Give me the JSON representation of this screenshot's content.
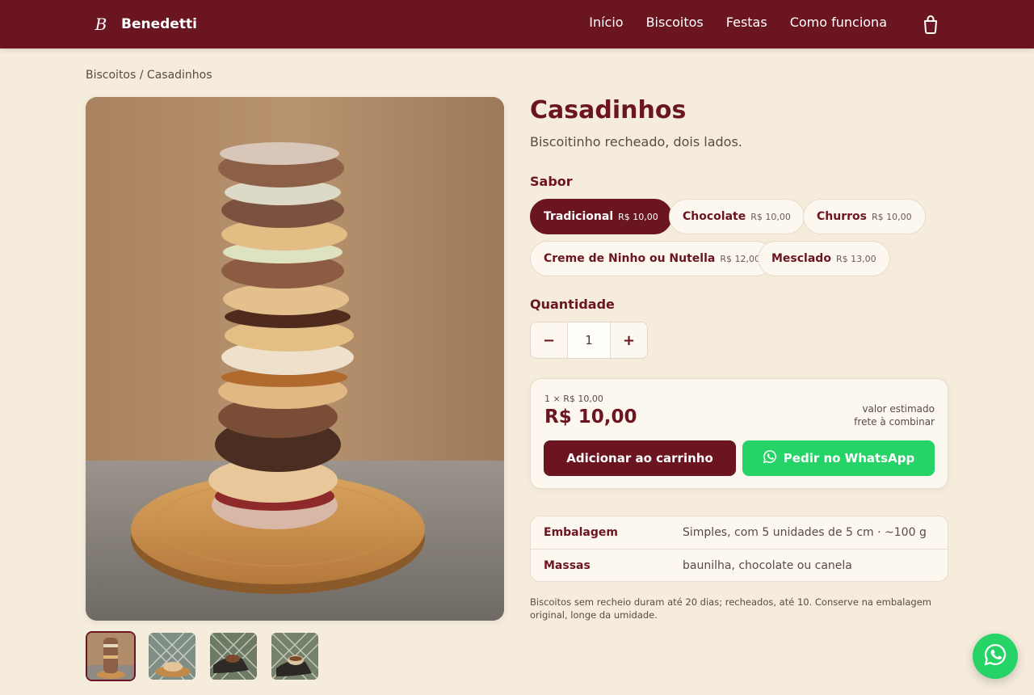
{
  "brand": {
    "name": "Benedetti",
    "monogram": "B"
  },
  "nav": {
    "items": [
      "Início",
      "Biscoitos",
      "Festas",
      "Como funciona"
    ]
  },
  "breadcrumb": {
    "parent": "Biscoitos",
    "separator": " / ",
    "current": "Casadinhos"
  },
  "product": {
    "title": "Casadinhos",
    "subtitle": "Biscoitinho recheado, dois lados."
  },
  "flavor": {
    "label": "Sabor",
    "selected": "Tradicional",
    "options": [
      {
        "name": "Tradicional",
        "price": "R$ 10,00"
      },
      {
        "name": "Chocolate",
        "price": "R$ 10,00"
      },
      {
        "name": "Churros",
        "price": "R$ 10,00"
      },
      {
        "name": "Creme de Ninho ou Nutella",
        "price": "R$ 12,00"
      },
      {
        "name": "Mesclado",
        "price": "R$ 13,00"
      }
    ]
  },
  "quantity": {
    "label": "Quantidade",
    "minus": "−",
    "value": "1",
    "plus": "+"
  },
  "summary": {
    "unit_line": "1 × R$ 10,00",
    "total": "R$ 10,00",
    "estimate_line1": "valor estimado",
    "estimate_line2": "frete à combinar",
    "add_to_cart": "Adicionar ao carrinho",
    "whatsapp": "Pedir no WhatsApp"
  },
  "specs": [
    {
      "key": "Embalagem",
      "value": "Simples, com 5 unidades de 5 cm · ~100 g"
    },
    {
      "key": "Massas",
      "value": "baunilha, chocolate ou canela"
    }
  ],
  "note": "Biscoitos sem recheio duram até 20 dias; recheados, até 10. Conserve na embalagem original, longe da umidade.",
  "gallery": {
    "thumb_count": 4,
    "active_index": 0
  },
  "colors": {
    "primary": "#6b1520",
    "background": "#f5ecdc",
    "whatsapp": "#25d366",
    "card": "#fdf8ef"
  },
  "icons": {
    "cart": "shopping-bag-icon",
    "whatsapp": "whatsapp-icon"
  }
}
